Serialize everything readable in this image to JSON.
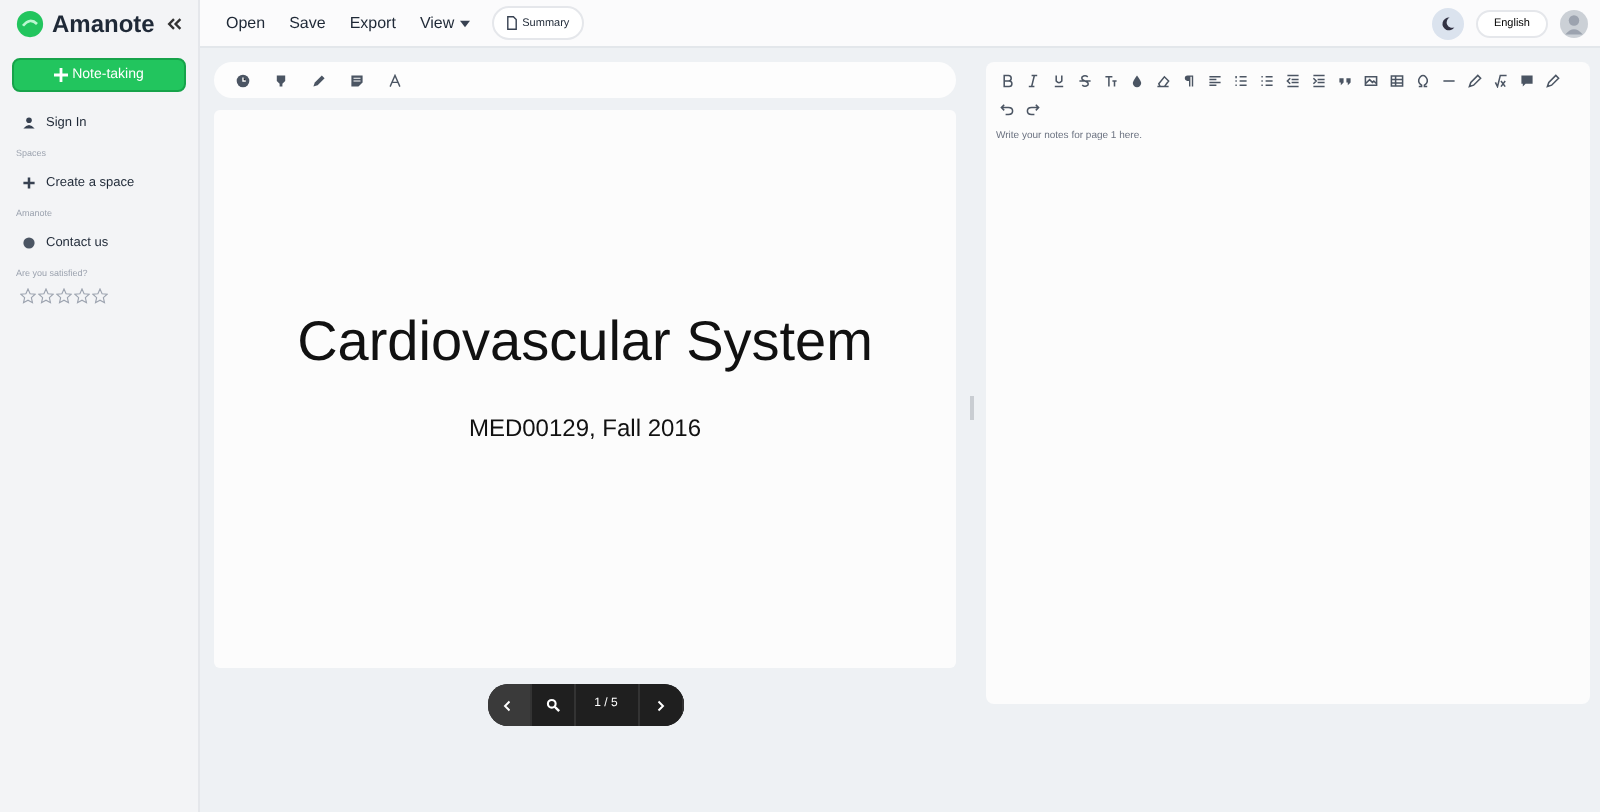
{
  "sidebar": {
    "brand": "Amanote",
    "new_button": "Note-taking",
    "items": [
      {
        "kind": "link",
        "label": "Sign In"
      },
      {
        "kind": "heading",
        "label": "Spaces"
      },
      {
        "kind": "link",
        "label": "Create a space"
      },
      {
        "kind": "heading",
        "label": "Amanote"
      },
      {
        "kind": "link",
        "label": "Contact us"
      },
      {
        "kind": "heading",
        "label": "Are you satisfied?"
      }
    ],
    "rating": {
      "stars": 0
    }
  },
  "menu": {
    "items": [
      "Open",
      "Save",
      "Export",
      "View"
    ],
    "summary": "Summary",
    "language": "English"
  },
  "slide": {
    "title": "Cardiovascular System",
    "subtitle": "MED00129, Fall 2016"
  },
  "pager": {
    "page": "1 / 5"
  },
  "editor": {
    "placeholder": "Write your notes for page 1 here."
  }
}
